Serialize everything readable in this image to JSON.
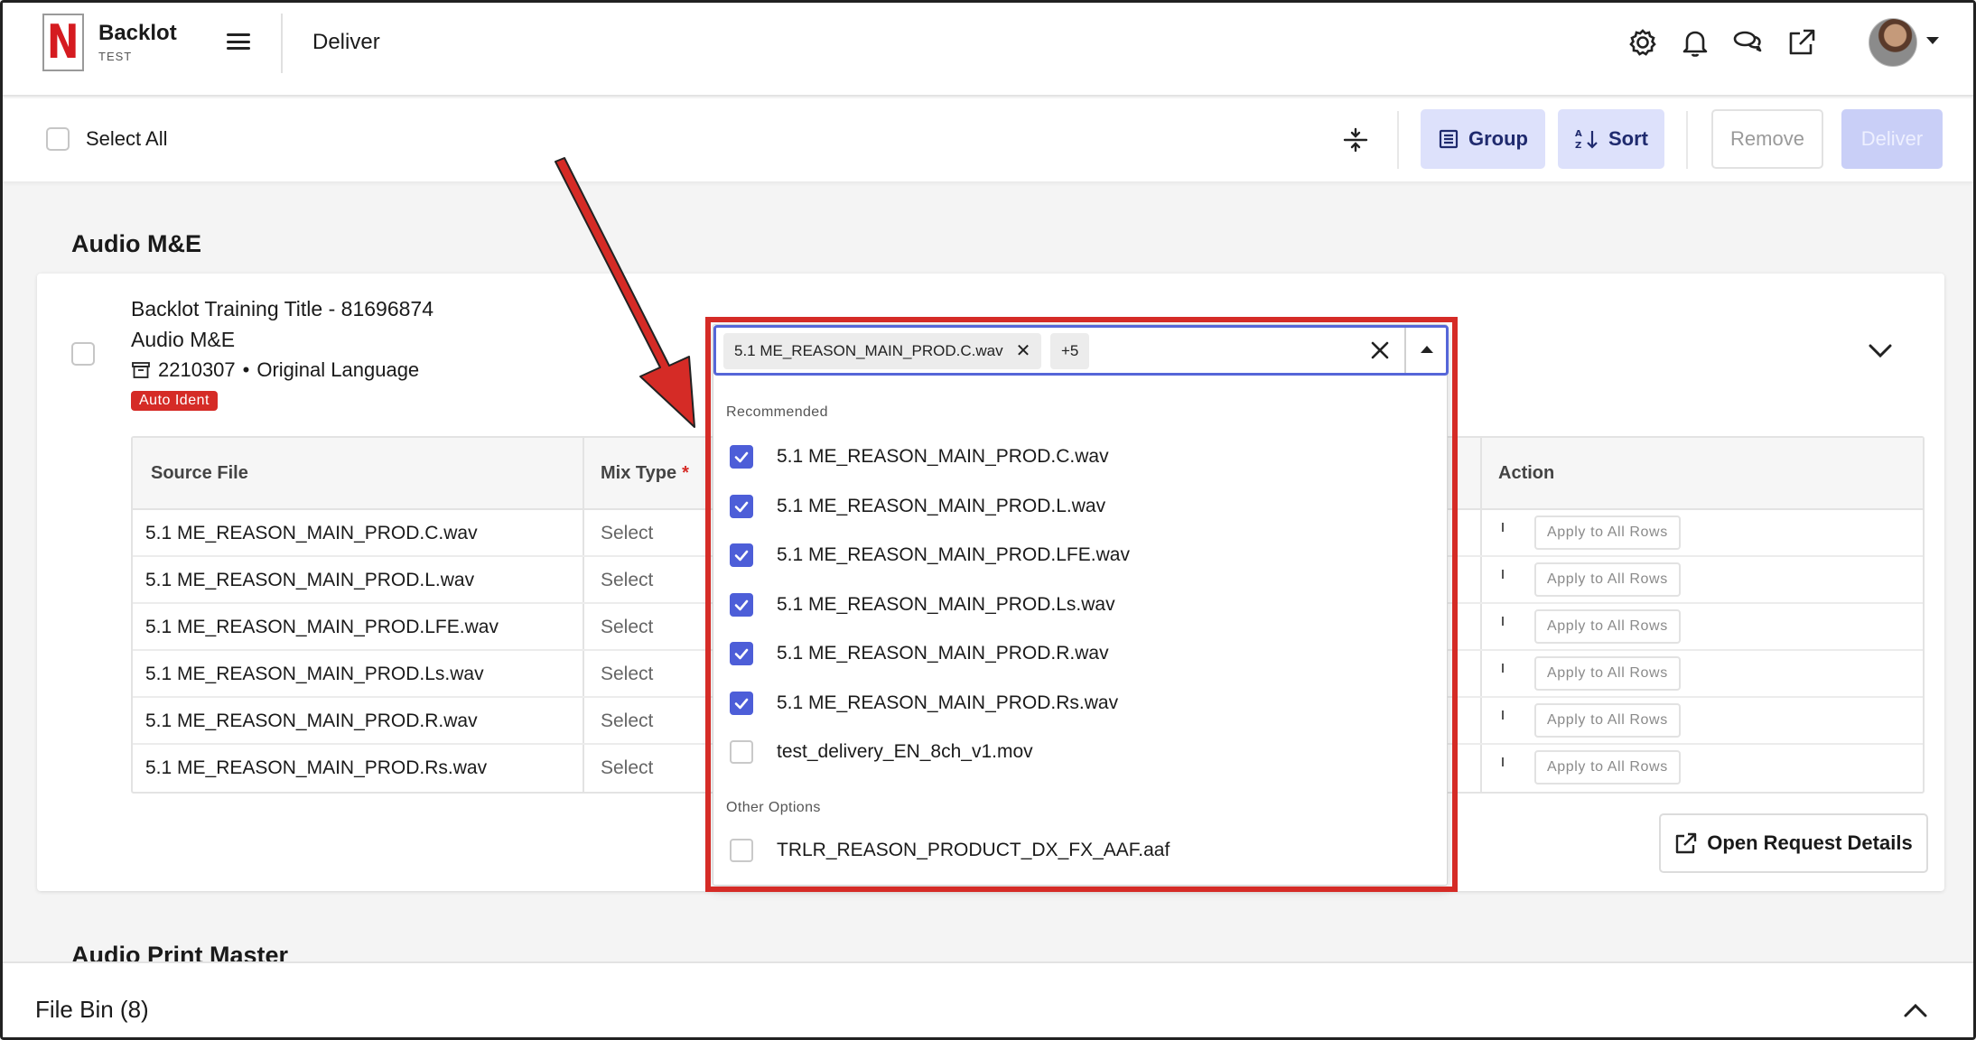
{
  "app": {
    "brand_letter": "N",
    "brand_name": "Backlot",
    "brand_sub": "TEST",
    "page_title": "Deliver"
  },
  "header_icons": [
    "gear-icon",
    "bell-icon",
    "chat-icon",
    "external-link-icon",
    "avatar"
  ],
  "toolbar": {
    "select_all": "Select All",
    "group": "Group",
    "sort": "Sort",
    "remove": "Remove",
    "deliver": "Deliver"
  },
  "section": {
    "title": "Audio M&E",
    "next_title": "Audio Print Master"
  },
  "card": {
    "title": "Backlot Training Title - 81696874",
    "subtitle": "Audio M&E",
    "id": "2210307",
    "separator": "•",
    "language": "Original Language",
    "badge": "Auto Ident",
    "open_request": "Open Request Details"
  },
  "table": {
    "headers": {
      "source_file": "Source File",
      "mix_type": "Mix Type",
      "required_mark": "*",
      "action": "Action"
    },
    "rows": [
      {
        "file": "5.1 ME_REASON_MAIN_PROD.C.wav",
        "mix": "Select",
        "action": "Apply to All Rows"
      },
      {
        "file": "5.1 ME_REASON_MAIN_PROD.L.wav",
        "mix": "Select",
        "action": "Apply to All Rows"
      },
      {
        "file": "5.1 ME_REASON_MAIN_PROD.LFE.wav",
        "mix": "Select",
        "action": "Apply to All Rows"
      },
      {
        "file": "5.1 ME_REASON_MAIN_PROD.Ls.wav",
        "mix": "Select",
        "action": "Apply to All Rows"
      },
      {
        "file": "5.1 ME_REASON_MAIN_PROD.R.wav",
        "mix": "Select",
        "action": "Apply to All Rows"
      },
      {
        "file": "5.1 ME_REASON_MAIN_PROD.Rs.wav",
        "mix": "Select",
        "action": "Apply to All Rows"
      }
    ]
  },
  "dropdown": {
    "chip": "5.1 ME_REASON_MAIN_PROD.C.wav",
    "more_chip": "+5",
    "group_recommended": "Recommended",
    "group_other": "Other Options",
    "recommended": [
      {
        "label": "5.1 ME_REASON_MAIN_PROD.C.wav",
        "checked": true
      },
      {
        "label": "5.1 ME_REASON_MAIN_PROD.L.wav",
        "checked": true
      },
      {
        "label": "5.1 ME_REASON_MAIN_PROD.LFE.wav",
        "checked": true
      },
      {
        "label": "5.1 ME_REASON_MAIN_PROD.Ls.wav",
        "checked": true
      },
      {
        "label": "5.1 ME_REASON_MAIN_PROD.R.wav",
        "checked": true
      },
      {
        "label": "5.1 ME_REASON_MAIN_PROD.Rs.wav",
        "checked": true
      },
      {
        "label": "test_delivery_EN_8ch_v1.mov",
        "checked": false
      }
    ],
    "other": [
      {
        "label": "TRLR_REASON_PRODUCT_DX_FX_AAF.aaf",
        "checked": false
      }
    ]
  },
  "file_bin": {
    "label": "File Bin (8)"
  },
  "colors": {
    "brand_red": "#d51b20",
    "accent": "#4d5ed8",
    "annotation": "#d52b26",
    "button_tint": "#dde1fb"
  }
}
